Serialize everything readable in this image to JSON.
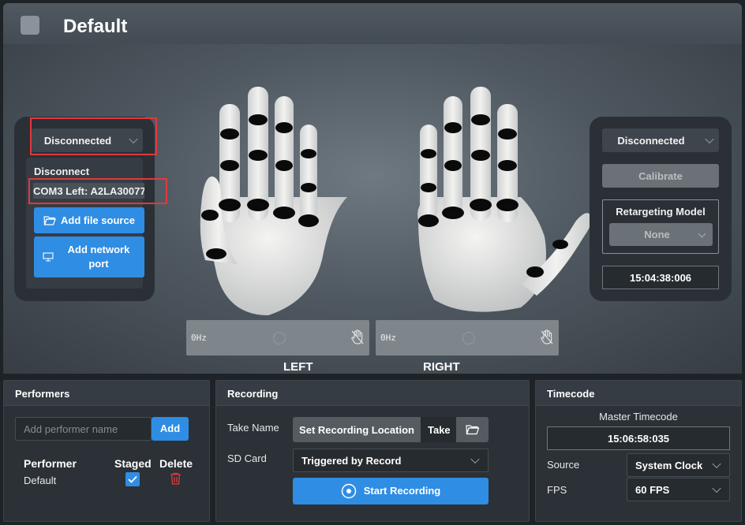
{
  "window": {
    "title": "Default"
  },
  "left_device": {
    "status": "Disconnected",
    "menu": {
      "disconnect_label": "Disconnect",
      "port_label": "COM3 Left: A2LA30077",
      "add_file_source_label": "Add file source",
      "add_network_port_label": "Add network port"
    },
    "rate": "0Hz",
    "hand_label": "LEFT"
  },
  "right_device": {
    "status": "Disconnected",
    "calibrate_label": "Calibrate",
    "retargeting_title": "Retargeting Model",
    "retargeting_value": "None",
    "timecode": "15:04:38:006",
    "rate": "0Hz",
    "hand_label": "RIGHT"
  },
  "performers": {
    "title": "Performers",
    "input_placeholder": "Add performer name",
    "add_label": "Add",
    "columns": [
      "Performer",
      "Staged",
      "Delete"
    ],
    "rows": [
      {
        "name": "Default",
        "staged": true
      }
    ]
  },
  "recording": {
    "title": "Recording",
    "take_name_label": "Take Name",
    "set_location_label": "Set Recording Location",
    "take_value": "Take",
    "sd_card_label": "SD Card",
    "sd_card_value": "Triggered by Record",
    "start_label": "Start Recording"
  },
  "timecode": {
    "title": "Timecode",
    "master_label": "Master Timecode",
    "master_value": "15:06:58:035",
    "source_label": "Source",
    "source_value": "System Clock",
    "fps_label": "FPS",
    "fps_value": "60 FPS"
  },
  "colors": {
    "accent": "#2f8de4",
    "annotation": "#e0393e",
    "delete": "#e0393e"
  }
}
